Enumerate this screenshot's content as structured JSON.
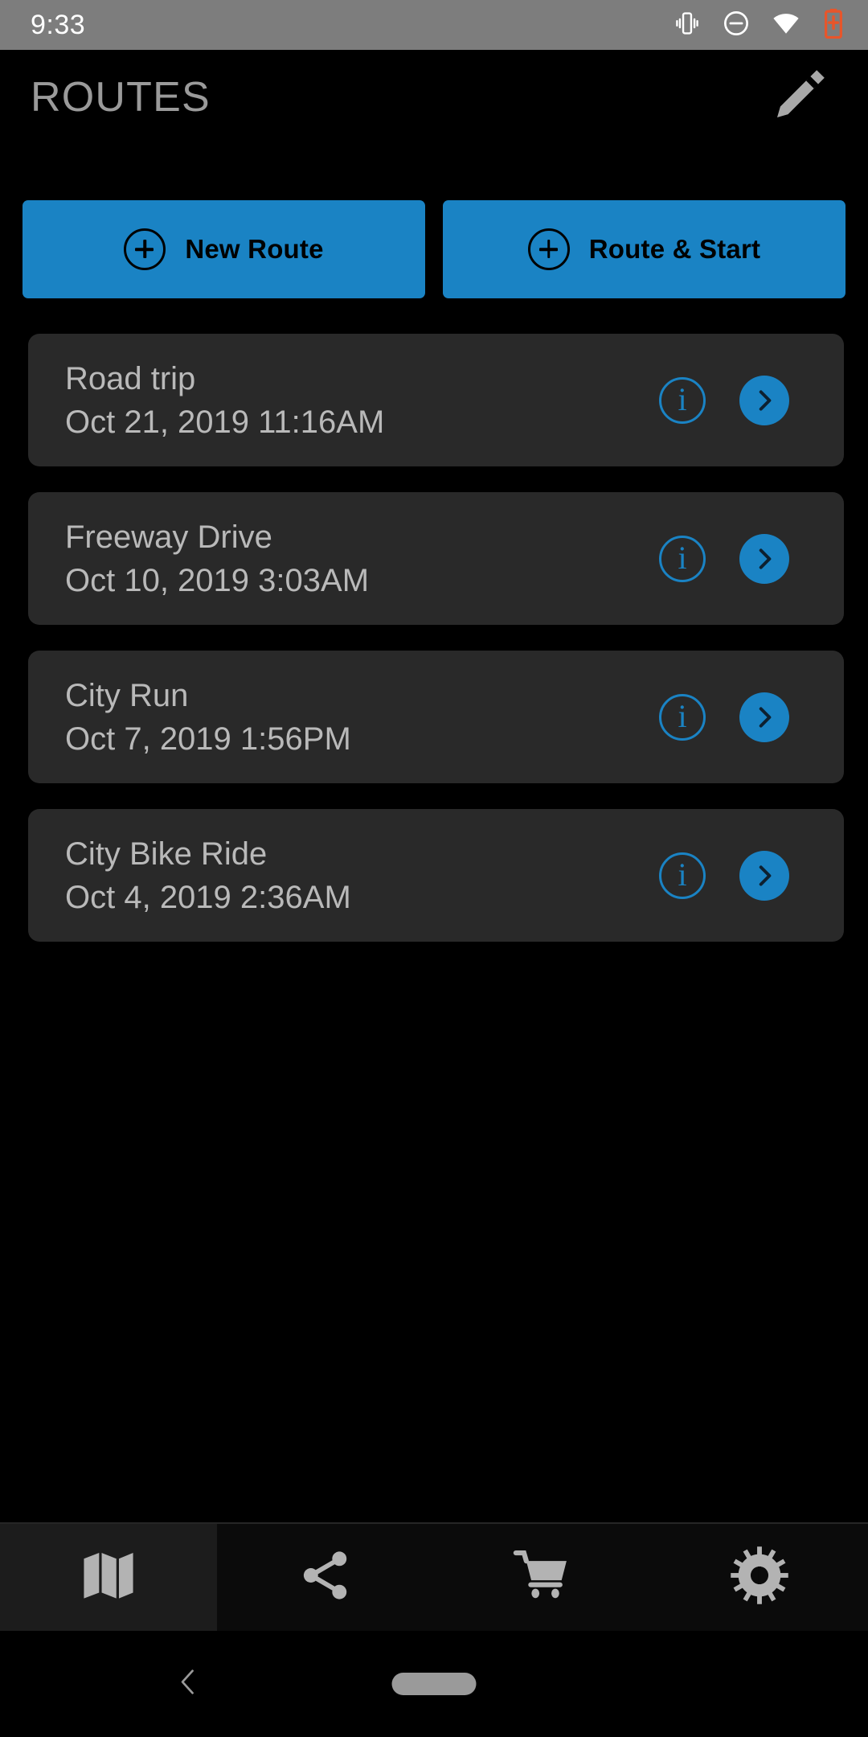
{
  "status_bar": {
    "time": "9:33",
    "icons": [
      "vibrate-icon",
      "do-not-disturb-icon",
      "wifi-icon",
      "battery-charging-icon"
    ],
    "background_color": "#7d7d7d",
    "battery_color": "#e8552a"
  },
  "header": {
    "title": "ROUTES",
    "edit_icon": "pencil-icon",
    "title_color": "#9a9a9a"
  },
  "actions": {
    "accent_color": "#1a83c4",
    "buttons": [
      {
        "label": "New Route",
        "icon": "plus-circle-icon"
      },
      {
        "label": "Route & Start",
        "icon": "plus-circle-icon"
      }
    ]
  },
  "routes": {
    "card_color": "#292929",
    "items": [
      {
        "name": "Road trip",
        "date": "Oct 21, 2019 11:16AM",
        "info_icon": "info-circle-icon",
        "go_icon": "chevron-right-icon"
      },
      {
        "name": "Freeway Drive",
        "date": "Oct 10, 2019 3:03AM",
        "info_icon": "info-circle-icon",
        "go_icon": "chevron-right-icon"
      },
      {
        "name": "City Run",
        "date": "Oct 7, 2019 1:56PM",
        "info_icon": "info-circle-icon",
        "go_icon": "chevron-right-icon"
      },
      {
        "name": "City Bike Ride",
        "date": "Oct 4, 2019 2:36AM",
        "info_icon": "info-circle-icon",
        "go_icon": "chevron-right-icon"
      }
    ]
  },
  "tabbar": {
    "selected_index": 0,
    "tabs": [
      {
        "icon": "map-icon",
        "name": "map"
      },
      {
        "icon": "share-icon",
        "name": "share"
      },
      {
        "icon": "cart-icon",
        "name": "store"
      },
      {
        "icon": "gear-icon",
        "name": "settings"
      }
    ]
  },
  "system_nav": {
    "back_icon": "chevron-left-icon",
    "home_icon": "home-pill-icon"
  }
}
